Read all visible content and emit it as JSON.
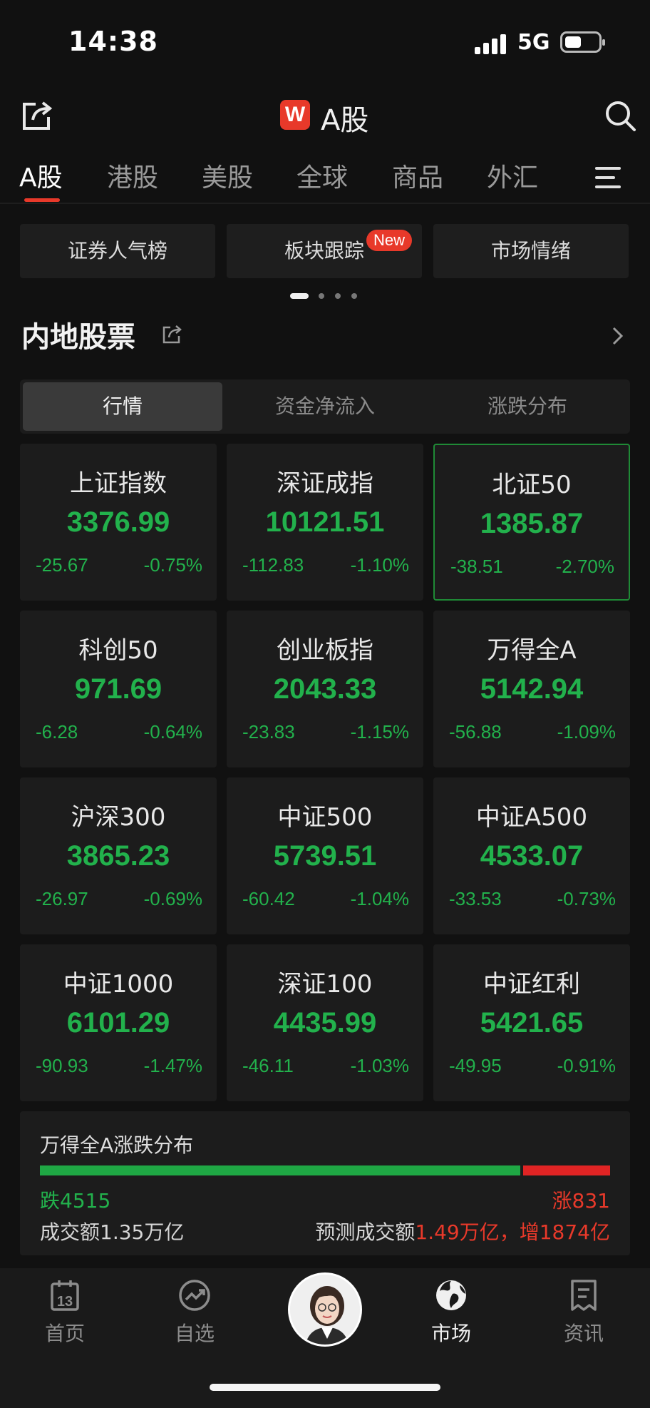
{
  "status_bar": {
    "time": "14:38",
    "network": "5G"
  },
  "header": {
    "logo_letter": "W",
    "title": "A股"
  },
  "market_tabs": [
    "A股",
    "港股",
    "美股",
    "全球",
    "商品",
    "外汇"
  ],
  "feature_buttons": [
    {
      "label": "证券人气榜"
    },
    {
      "label": "板块跟踪",
      "badge": "New"
    },
    {
      "label": "市场情绪"
    }
  ],
  "section": {
    "title": "内地股票"
  },
  "segments": [
    "行情",
    "资金净流入",
    "涨跌分布"
  ],
  "indices": [
    {
      "name": "上证指数",
      "value": "3376.99",
      "change": "-25.67",
      "pct": "-0.75%"
    },
    {
      "name": "深证成指",
      "value": "10121.51",
      "change": "-112.83",
      "pct": "-1.10%"
    },
    {
      "name": "北证50",
      "value": "1385.87",
      "change": "-38.51",
      "pct": "-2.70%"
    },
    {
      "name": "科创50",
      "value": "971.69",
      "change": "-6.28",
      "pct": "-0.64%"
    },
    {
      "name": "创业板指",
      "value": "2043.33",
      "change": "-23.83",
      "pct": "-1.15%"
    },
    {
      "name": "万得全A",
      "value": "5142.94",
      "change": "-56.88",
      "pct": "-1.09%"
    },
    {
      "name": "沪深300",
      "value": "3865.23",
      "change": "-26.97",
      "pct": "-0.69%"
    },
    {
      "name": "中证500",
      "value": "5739.51",
      "change": "-60.42",
      "pct": "-1.04%"
    },
    {
      "name": "中证A500",
      "value": "4533.07",
      "change": "-33.53",
      "pct": "-0.73%"
    },
    {
      "name": "中证1000",
      "value": "6101.29",
      "change": "-90.93",
      "pct": "-1.47%"
    },
    {
      "name": "深证100",
      "value": "4435.99",
      "change": "-46.11",
      "pct": "-1.03%"
    },
    {
      "name": "中证红利",
      "value": "5421.65",
      "change": "-49.95",
      "pct": "-0.91%"
    }
  ],
  "distribution": {
    "title": "万得全A涨跌分布",
    "fall_label": "跌4515",
    "rise_label": "涨831",
    "fall_count": 4515,
    "rise_count": 831,
    "turnover": "成交额1.35万亿",
    "forecast_prefix": "预测成交额",
    "forecast_value": "1.49万亿，增1874亿"
  },
  "bottom_nav": [
    {
      "label": "首页",
      "icon": "calendar-icon",
      "calendar_day": "13"
    },
    {
      "label": "自选",
      "icon": "trend-icon"
    },
    {
      "label": "市场",
      "icon": "globe-icon"
    },
    {
      "label": "资讯",
      "icon": "news-icon"
    }
  ],
  "colors": {
    "down": "#22b14c",
    "up": "#e8392a",
    "accent": "#e8392a",
    "background": "#111111",
    "card": "#1c1c1c"
  }
}
